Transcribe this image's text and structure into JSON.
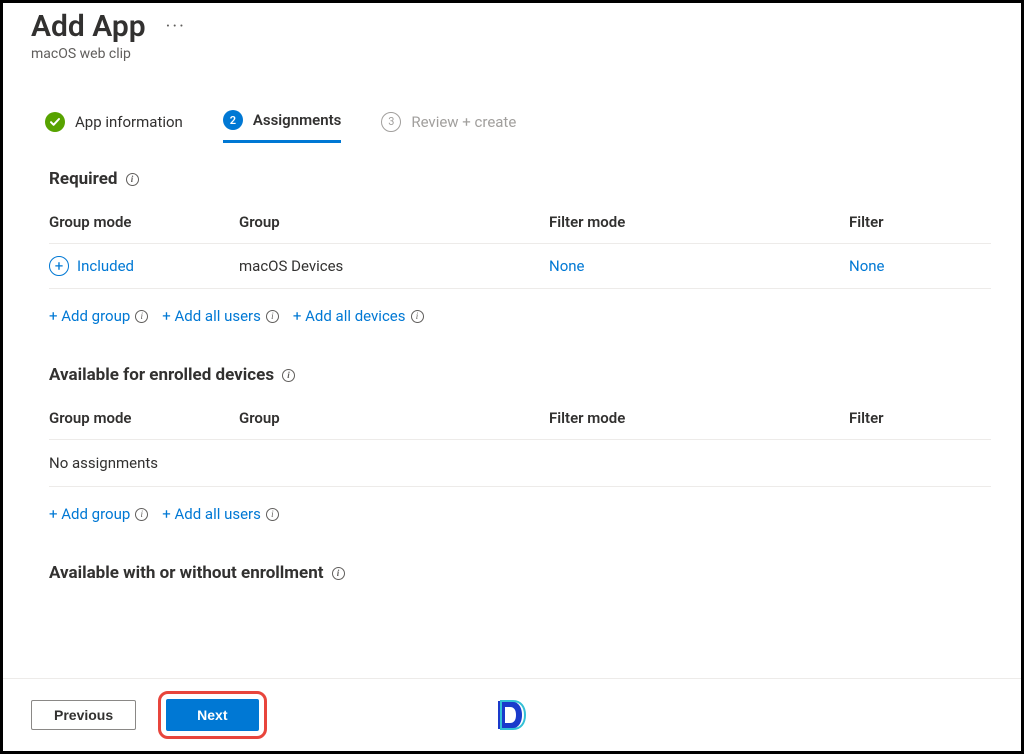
{
  "header": {
    "title": "Add App",
    "subtitle": "macOS web clip"
  },
  "wizard": {
    "step1": {
      "number": "1",
      "label": "App information"
    },
    "step2": {
      "number": "2",
      "label": "Assignments"
    },
    "step3": {
      "number": "3",
      "label": "Review + create"
    }
  },
  "sections": {
    "required": {
      "title": "Required",
      "columns": {
        "group_mode": "Group mode",
        "group": "Group",
        "filter_mode": "Filter mode",
        "filter": "Filter"
      },
      "row": {
        "group_mode": "Included",
        "group": "macOS Devices",
        "filter_mode": "None",
        "filter": "None"
      },
      "actions": {
        "add_group": "+ Add group",
        "add_all_users": "+ Add all users",
        "add_all_devices": "+ Add all devices"
      }
    },
    "available_enrolled": {
      "title": "Available for enrolled devices",
      "columns": {
        "group_mode": "Group mode",
        "group": "Group",
        "filter_mode": "Filter mode",
        "filter": "Filter"
      },
      "empty": "No assignments",
      "actions": {
        "add_group": "+ Add group",
        "add_all_users": "+ Add all users"
      }
    },
    "available_any": {
      "title": "Available with or without enrollment"
    }
  },
  "footer": {
    "previous": "Previous",
    "next": "Next"
  }
}
